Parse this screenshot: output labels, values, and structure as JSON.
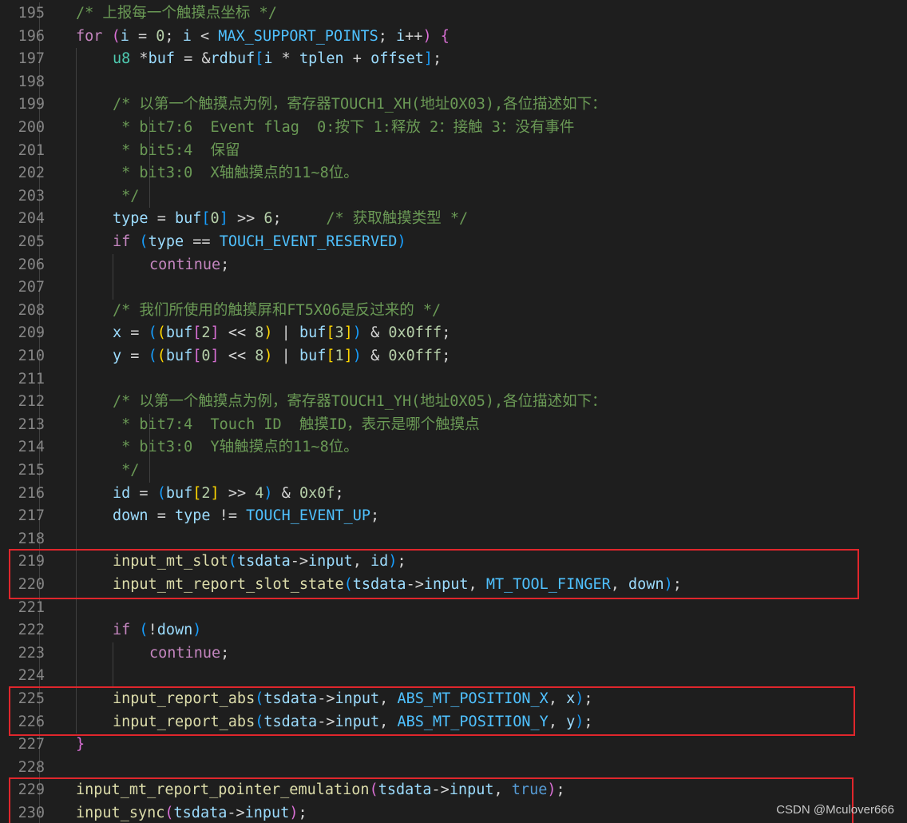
{
  "editor": {
    "lines": [
      {
        "num": "195",
        "indent": 1,
        "tokens": [
          {
            "t": "/* 上报每一个触摸点坐标 */",
            "c": "comment"
          }
        ]
      },
      {
        "num": "196",
        "indent": 1,
        "tokens": [
          {
            "t": "for",
            "c": "keyword"
          },
          {
            "t": " ",
            "c": "op"
          },
          {
            "t": "(",
            "c": "b2"
          },
          {
            "t": "i",
            "c": "var"
          },
          {
            "t": " = ",
            "c": "op"
          },
          {
            "t": "0",
            "c": "num"
          },
          {
            "t": "; ",
            "c": "op"
          },
          {
            "t": "i",
            "c": "var"
          },
          {
            "t": " < ",
            "c": "op"
          },
          {
            "t": "MAX_SUPPORT_POINTS",
            "c": "const"
          },
          {
            "t": "; ",
            "c": "op"
          },
          {
            "t": "i",
            "c": "var"
          },
          {
            "t": "++",
            "c": "op"
          },
          {
            "t": ")",
            "c": "b2"
          },
          {
            "t": " ",
            "c": "op"
          },
          {
            "t": "{",
            "c": "b2"
          }
        ]
      },
      {
        "num": "197",
        "indent": 2,
        "tokens": [
          {
            "t": "u8",
            "c": "type"
          },
          {
            "t": " *",
            "c": "op"
          },
          {
            "t": "buf",
            "c": "var"
          },
          {
            "t": " = &",
            "c": "op"
          },
          {
            "t": "rdbuf",
            "c": "var"
          },
          {
            "t": "[",
            "c": "b3"
          },
          {
            "t": "i",
            "c": "var"
          },
          {
            "t": " * ",
            "c": "op"
          },
          {
            "t": "tplen",
            "c": "var"
          },
          {
            "t": " + ",
            "c": "op"
          },
          {
            "t": "offset",
            "c": "var"
          },
          {
            "t": "]",
            "c": "b3"
          },
          {
            "t": ";",
            "c": "op"
          }
        ]
      },
      {
        "num": "198",
        "indent": 2,
        "tokens": []
      },
      {
        "num": "199",
        "indent": 2,
        "tokens": [
          {
            "t": "/* 以第一个触摸点为例，寄存器TOUCH1_XH(地址0X03),各位描述如下：",
            "c": "comment"
          }
        ]
      },
      {
        "num": "200",
        "indent": 2,
        "tokens": [
          {
            "t": " * bit7:6  Event flag  0:按下 1:释放 2：接触 3：没有事件",
            "c": "comment"
          }
        ]
      },
      {
        "num": "201",
        "indent": 2,
        "tokens": [
          {
            "t": " * bit5:4  保留",
            "c": "comment"
          }
        ]
      },
      {
        "num": "202",
        "indent": 2,
        "tokens": [
          {
            "t": " * bit3:0  X轴触摸点的11~8位。",
            "c": "comment"
          }
        ]
      },
      {
        "num": "203",
        "indent": 2,
        "tokens": [
          {
            "t": " */",
            "c": "comment"
          }
        ]
      },
      {
        "num": "204",
        "indent": 2,
        "tokens": [
          {
            "t": "type",
            "c": "var"
          },
          {
            "t": " = ",
            "c": "op"
          },
          {
            "t": "buf",
            "c": "var"
          },
          {
            "t": "[",
            "c": "b3"
          },
          {
            "t": "0",
            "c": "num"
          },
          {
            "t": "]",
            "c": "b3"
          },
          {
            "t": " >> ",
            "c": "op"
          },
          {
            "t": "6",
            "c": "num"
          },
          {
            "t": ";     ",
            "c": "op"
          },
          {
            "t": "/* 获取触摸类型 */",
            "c": "comment"
          }
        ]
      },
      {
        "num": "205",
        "indent": 2,
        "tokens": [
          {
            "t": "if",
            "c": "keyword"
          },
          {
            "t": " ",
            "c": "op"
          },
          {
            "t": "(",
            "c": "b3"
          },
          {
            "t": "type",
            "c": "var"
          },
          {
            "t": " == ",
            "c": "op"
          },
          {
            "t": "TOUCH_EVENT_RESERVED",
            "c": "const"
          },
          {
            "t": ")",
            "c": "b3"
          }
        ]
      },
      {
        "num": "206",
        "indent": 3,
        "tokens": [
          {
            "t": "continue",
            "c": "keyword"
          },
          {
            "t": ";",
            "c": "op"
          }
        ]
      },
      {
        "num": "207",
        "indent": 2,
        "tokens": []
      },
      {
        "num": "208",
        "indent": 2,
        "tokens": [
          {
            "t": "/* 我们所使用的触摸屏和FT5X06是反过来的 */",
            "c": "comment"
          }
        ]
      },
      {
        "num": "209",
        "indent": 2,
        "tokens": [
          {
            "t": "x",
            "c": "var"
          },
          {
            "t": " = ",
            "c": "op"
          },
          {
            "t": "(",
            "c": "b3"
          },
          {
            "t": "(",
            "c": "b1"
          },
          {
            "t": "buf",
            "c": "var"
          },
          {
            "t": "[",
            "c": "b2"
          },
          {
            "t": "2",
            "c": "num"
          },
          {
            "t": "]",
            "c": "b2"
          },
          {
            "t": " << ",
            "c": "op"
          },
          {
            "t": "8",
            "c": "num"
          },
          {
            "t": ")",
            "c": "b1"
          },
          {
            "t": " | ",
            "c": "op"
          },
          {
            "t": "buf",
            "c": "var"
          },
          {
            "t": "[",
            "c": "b1"
          },
          {
            "t": "3",
            "c": "num"
          },
          {
            "t": "]",
            "c": "b1"
          },
          {
            "t": ")",
            "c": "b3"
          },
          {
            "t": " & ",
            "c": "op"
          },
          {
            "t": "0x0fff",
            "c": "num"
          },
          {
            "t": ";",
            "c": "op"
          }
        ]
      },
      {
        "num": "210",
        "indent": 2,
        "tokens": [
          {
            "t": "y",
            "c": "var"
          },
          {
            "t": " = ",
            "c": "op"
          },
          {
            "t": "(",
            "c": "b3"
          },
          {
            "t": "(",
            "c": "b1"
          },
          {
            "t": "buf",
            "c": "var"
          },
          {
            "t": "[",
            "c": "b2"
          },
          {
            "t": "0",
            "c": "num"
          },
          {
            "t": "]",
            "c": "b2"
          },
          {
            "t": " << ",
            "c": "op"
          },
          {
            "t": "8",
            "c": "num"
          },
          {
            "t": ")",
            "c": "b1"
          },
          {
            "t": " | ",
            "c": "op"
          },
          {
            "t": "buf",
            "c": "var"
          },
          {
            "t": "[",
            "c": "b1"
          },
          {
            "t": "1",
            "c": "num"
          },
          {
            "t": "]",
            "c": "b1"
          },
          {
            "t": ")",
            "c": "b3"
          },
          {
            "t": " & ",
            "c": "op"
          },
          {
            "t": "0x0fff",
            "c": "num"
          },
          {
            "t": ";",
            "c": "op"
          }
        ]
      },
      {
        "num": "211",
        "indent": 2,
        "tokens": []
      },
      {
        "num": "212",
        "indent": 2,
        "tokens": [
          {
            "t": "/* 以第一个触摸点为例，寄存器TOUCH1_YH(地址0X05),各位描述如下：",
            "c": "comment"
          }
        ]
      },
      {
        "num": "213",
        "indent": 2,
        "tokens": [
          {
            "t": " * bit7:4  Touch ID  触摸ID，表示是哪个触摸点",
            "c": "comment"
          }
        ]
      },
      {
        "num": "214",
        "indent": 2,
        "tokens": [
          {
            "t": " * bit3:0  Y轴触摸点的11~8位。",
            "c": "comment"
          }
        ]
      },
      {
        "num": "215",
        "indent": 2,
        "tokens": [
          {
            "t": " */",
            "c": "comment"
          }
        ]
      },
      {
        "num": "216",
        "indent": 2,
        "tokens": [
          {
            "t": "id",
            "c": "var"
          },
          {
            "t": " = ",
            "c": "op"
          },
          {
            "t": "(",
            "c": "b3"
          },
          {
            "t": "buf",
            "c": "var"
          },
          {
            "t": "[",
            "c": "b1"
          },
          {
            "t": "2",
            "c": "num"
          },
          {
            "t": "]",
            "c": "b1"
          },
          {
            "t": " >> ",
            "c": "op"
          },
          {
            "t": "4",
            "c": "num"
          },
          {
            "t": ")",
            "c": "b3"
          },
          {
            "t": " & ",
            "c": "op"
          },
          {
            "t": "0x0f",
            "c": "num"
          },
          {
            "t": ";",
            "c": "op"
          }
        ]
      },
      {
        "num": "217",
        "indent": 2,
        "tokens": [
          {
            "t": "down",
            "c": "var"
          },
          {
            "t": " = ",
            "c": "op"
          },
          {
            "t": "type",
            "c": "var"
          },
          {
            "t": " != ",
            "c": "op"
          },
          {
            "t": "TOUCH_EVENT_UP",
            "c": "const"
          },
          {
            "t": ";",
            "c": "op"
          }
        ]
      },
      {
        "num": "218",
        "indent": 2,
        "tokens": []
      },
      {
        "num": "219",
        "indent": 2,
        "tokens": [
          {
            "t": "input_mt_slot",
            "c": "fn"
          },
          {
            "t": "(",
            "c": "b3"
          },
          {
            "t": "tsdata",
            "c": "var"
          },
          {
            "t": "->",
            "c": "op"
          },
          {
            "t": "input",
            "c": "var"
          },
          {
            "t": ", ",
            "c": "op"
          },
          {
            "t": "id",
            "c": "var"
          },
          {
            "t": ")",
            "c": "b3"
          },
          {
            "t": ";",
            "c": "op"
          }
        ]
      },
      {
        "num": "220",
        "indent": 2,
        "tokens": [
          {
            "t": "input_mt_report_slot_state",
            "c": "fn"
          },
          {
            "t": "(",
            "c": "b3"
          },
          {
            "t": "tsdata",
            "c": "var"
          },
          {
            "t": "->",
            "c": "op"
          },
          {
            "t": "input",
            "c": "var"
          },
          {
            "t": ", ",
            "c": "op"
          },
          {
            "t": "MT_TOOL_FINGER",
            "c": "const"
          },
          {
            "t": ", ",
            "c": "op"
          },
          {
            "t": "down",
            "c": "var"
          },
          {
            "t": ")",
            "c": "b3"
          },
          {
            "t": ";",
            "c": "op"
          }
        ]
      },
      {
        "num": "221",
        "indent": 2,
        "tokens": []
      },
      {
        "num": "222",
        "indent": 2,
        "tokens": [
          {
            "t": "if",
            "c": "keyword"
          },
          {
            "t": " ",
            "c": "op"
          },
          {
            "t": "(",
            "c": "b3"
          },
          {
            "t": "!",
            "c": "op"
          },
          {
            "t": "down",
            "c": "var"
          },
          {
            "t": ")",
            "c": "b3"
          }
        ]
      },
      {
        "num": "223",
        "indent": 3,
        "tokens": [
          {
            "t": "continue",
            "c": "keyword"
          },
          {
            "t": ";",
            "c": "op"
          }
        ]
      },
      {
        "num": "224",
        "indent": 2,
        "tokens": []
      },
      {
        "num": "225",
        "indent": 2,
        "tokens": [
          {
            "t": "input_report_abs",
            "c": "fn"
          },
          {
            "t": "(",
            "c": "b3"
          },
          {
            "t": "tsdata",
            "c": "var"
          },
          {
            "t": "->",
            "c": "op"
          },
          {
            "t": "input",
            "c": "var"
          },
          {
            "t": ", ",
            "c": "op"
          },
          {
            "t": "ABS_MT_POSITION_X",
            "c": "const"
          },
          {
            "t": ", ",
            "c": "op"
          },
          {
            "t": "x",
            "c": "var"
          },
          {
            "t": ")",
            "c": "b3"
          },
          {
            "t": ";",
            "c": "op"
          }
        ]
      },
      {
        "num": "226",
        "indent": 2,
        "tokens": [
          {
            "t": "input_report_abs",
            "c": "fn"
          },
          {
            "t": "(",
            "c": "b3"
          },
          {
            "t": "tsdata",
            "c": "var"
          },
          {
            "t": "->",
            "c": "op"
          },
          {
            "t": "input",
            "c": "var"
          },
          {
            "t": ", ",
            "c": "op"
          },
          {
            "t": "ABS_MT_POSITION_Y",
            "c": "const"
          },
          {
            "t": ", ",
            "c": "op"
          },
          {
            "t": "y",
            "c": "var"
          },
          {
            "t": ")",
            "c": "b3"
          },
          {
            "t": ";",
            "c": "op"
          }
        ]
      },
      {
        "num": "227",
        "indent": 1,
        "tokens": [
          {
            "t": "}",
            "c": "b2"
          }
        ]
      },
      {
        "num": "228",
        "indent": 1,
        "tokens": []
      },
      {
        "num": "229",
        "indent": 1,
        "tokens": [
          {
            "t": "input_mt_report_pointer_emulation",
            "c": "fn"
          },
          {
            "t": "(",
            "c": "b2"
          },
          {
            "t": "tsdata",
            "c": "var"
          },
          {
            "t": "->",
            "c": "op"
          },
          {
            "t": "input",
            "c": "var"
          },
          {
            "t": ", ",
            "c": "op"
          },
          {
            "t": "true",
            "c": "bool"
          },
          {
            "t": ")",
            "c": "b2"
          },
          {
            "t": ";",
            "c": "op"
          }
        ]
      },
      {
        "num": "230",
        "indent": 1,
        "tokens": [
          {
            "t": "input_sync",
            "c": "fn"
          },
          {
            "t": "(",
            "c": "b2"
          },
          {
            "t": "tsdata",
            "c": "var"
          },
          {
            "t": "->",
            "c": "op"
          },
          {
            "t": "input",
            "c": "var"
          },
          {
            "t": ")",
            "c": "b2"
          },
          {
            "t": ";",
            "c": "op"
          }
        ]
      }
    ]
  },
  "highlights": [
    {
      "from_line": "219",
      "to_line": "220"
    },
    {
      "from_line": "225",
      "to_line": "226"
    },
    {
      "from_line": "229",
      "to_line": "230"
    }
  ],
  "colors": {
    "background": "#1e1e1e",
    "highlight_border": "#e0262c",
    "comment": "#6a9955",
    "keyword": "#c586c0",
    "function": "#dcdcaa",
    "variable": "#9cdcfe",
    "constant": "#4fc1ff",
    "number": "#b5cea8"
  },
  "watermark": {
    "text": "CSDN @Mculover666"
  }
}
